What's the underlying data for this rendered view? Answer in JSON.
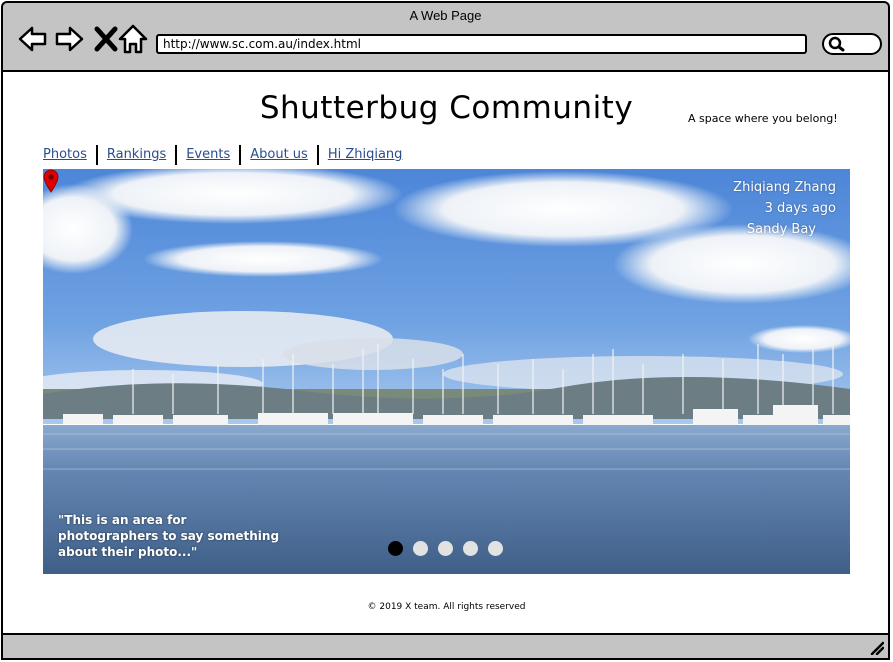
{
  "browser": {
    "window_title": "A Web Page",
    "url": "http://www.sc.com.au/index.html"
  },
  "header": {
    "site_title": "Shutterbug Community",
    "tagline": "A space where you belong!"
  },
  "nav": {
    "items": [
      {
        "label": "Photos"
      },
      {
        "label": "Rankings"
      },
      {
        "label": "Events"
      },
      {
        "label": "About us"
      },
      {
        "label": "Hi Zhiqiang"
      }
    ]
  },
  "hero": {
    "author": "Zhiqiang Zhang",
    "posted": "3 days ago",
    "location": "Sandy Bay",
    "caption": "\"This is an area for photographers to say something about their photo...\"",
    "slides_total": 5,
    "active_slide": 1,
    "pin_color": "#e00000"
  },
  "footer": {
    "copyright": "© 2019 X team. All rights reserved"
  }
}
